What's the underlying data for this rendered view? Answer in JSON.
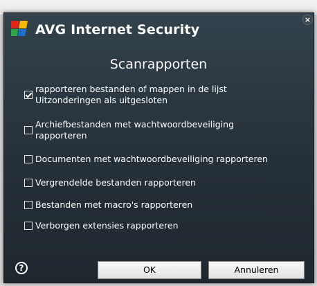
{
  "app": {
    "brand": "AVG",
    "product": "Internet Security"
  },
  "dialog": {
    "title": "Scanrapporten"
  },
  "options": [
    {
      "label_line1": "rapporteren bestanden of mappen in de lijst",
      "label_line2": "Uitzonderingen als uitgesloten",
      "checked": true
    },
    {
      "label_line1": "Archiefbestanden met wachtwoordbeveiliging",
      "label_line2": "rapporteren",
      "checked": false
    },
    {
      "label_line1": "Documenten met wachtwoordbeveiliging rapporteren",
      "checked": false
    },
    {
      "label_line1": "Vergrendelde bestanden rapporteren",
      "checked": false
    },
    {
      "label_line1": "Bestanden met macro's rapporteren",
      "checked": false
    },
    {
      "label_line1": "Verborgen extensies rapporteren",
      "checked": false
    }
  ],
  "buttons": {
    "ok": "OK",
    "cancel": "Annuleren",
    "close": "×",
    "help": "?"
  },
  "colors": {
    "background": "#263038",
    "text": "#ffffff",
    "logo_red": "#e0261b",
    "logo_yellow": "#f5b800",
    "logo_green": "#2ea44a",
    "logo_blue": "#1f6fd1"
  }
}
